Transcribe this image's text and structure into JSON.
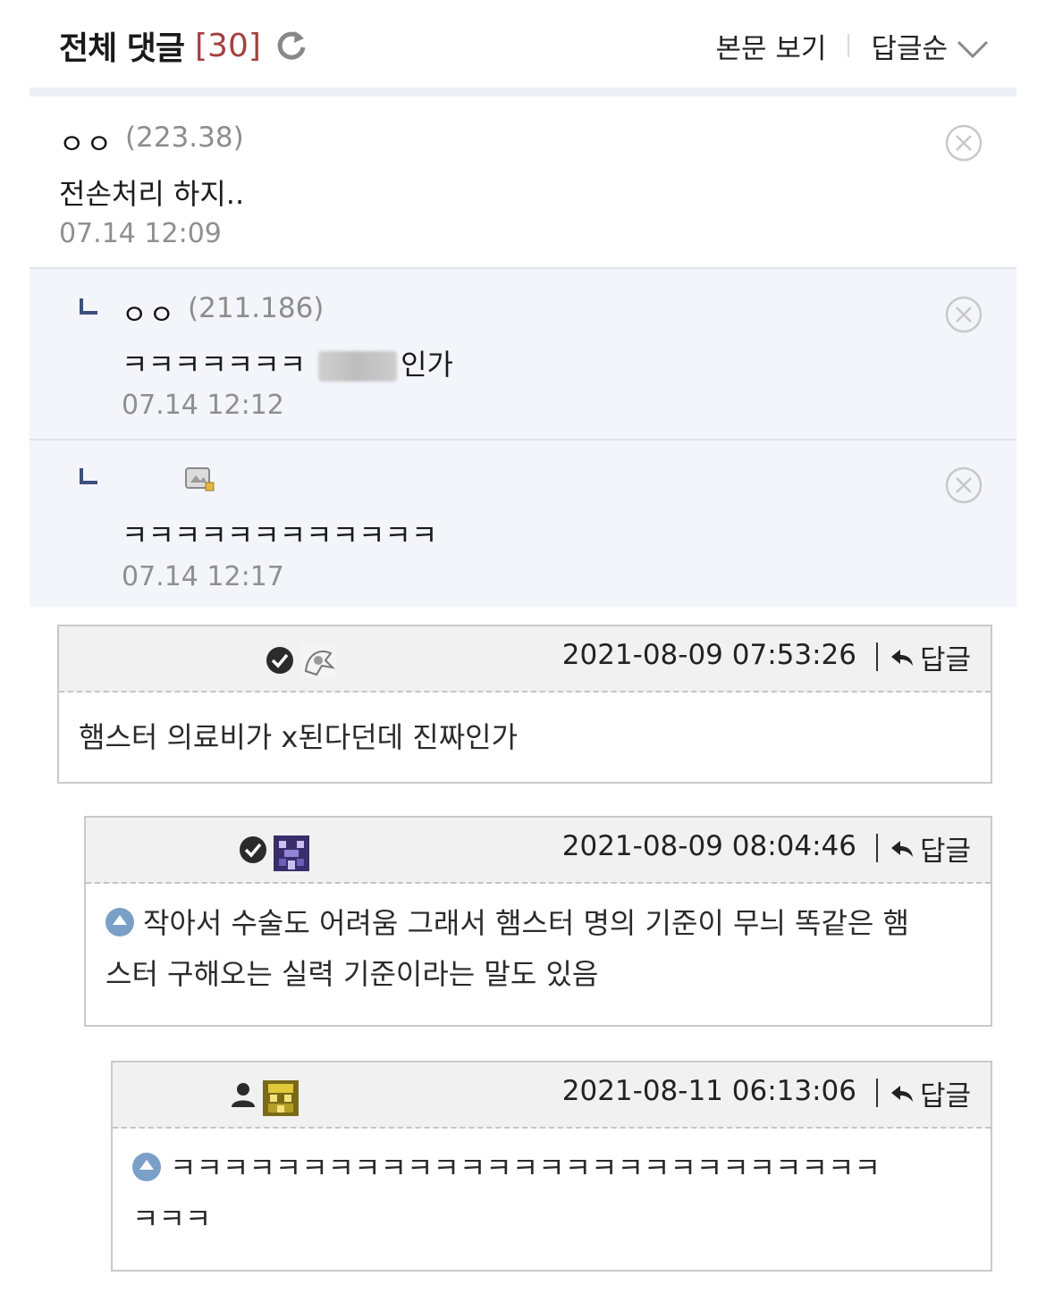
{
  "header": {
    "title": "전체 댓글",
    "count": "[30]",
    "refresh_icon": "refresh-icon",
    "view_post_label": "본문 보기",
    "sort_label": "답글순",
    "sort_icon": "chevron-down-icon"
  },
  "comments": [
    {
      "name": "ㅇㅇ",
      "ip": "(223.38)",
      "text": "전손처리 하지..",
      "date": "07.14 12:09"
    },
    {
      "name": "ㅇㅇ",
      "ip": "(211.186)",
      "text_before": "ㅋㅋㅋㅋㅋㅋㅋ",
      "text_after": "인가",
      "date": "07.14 12:12"
    },
    {
      "text": "ㅋㅋㅋㅋㅋㅋㅋㅋㅋㅋㅋㅋ",
      "date": "07.14 12:17"
    }
  ],
  "threads": [
    {
      "date": "2021-08-09 07:53:26",
      "reply_label": "답글",
      "text": "햄스터 의료비가 x된다던데 진짜인가"
    },
    {
      "date": "2021-08-09 08:04:46",
      "reply_label": "답글",
      "line1": "작아서 수술도 어려움 그래서 햄스터 명의 기준이 무늬 똑같은 햄",
      "line2": "스터 구해오는 실력 기준이라는 말도 있음"
    },
    {
      "date": "2021-08-11 06:13:06",
      "reply_label": "답글",
      "line1": "ㅋㅋㅋㅋㅋㅋㅋㅋㅋㅋㅋㅋㅋㅋㅋㅋㅋㅋㅋㅋㅋㅋㅋㅋㅋㅋㅋ",
      "line2": "ㅋㅋㅋ"
    }
  ],
  "colors": {
    "accent_count": "#a4403f",
    "reply_bg": "#f3f5fb",
    "box_head": "#f1f1f1",
    "badge": "#7aa0c8"
  }
}
